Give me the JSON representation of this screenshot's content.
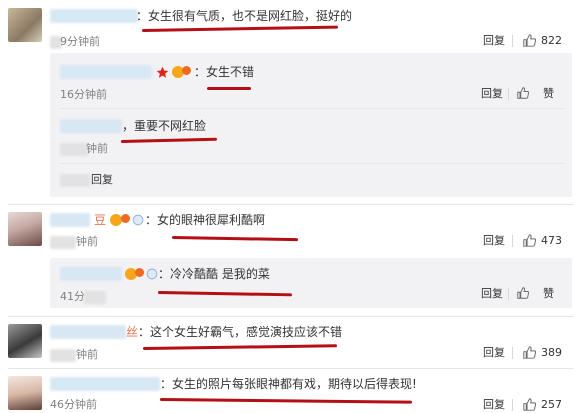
{
  "comments": [
    {
      "text": "：女生很有气质，也不是网红脸，挺好的",
      "time": "9分钟前",
      "reply": "回复",
      "likes": "822",
      "replies": [
        {
          "text": "：女生不错",
          "time": "16分钟前",
          "reply": "回复",
          "likes": "赞"
        },
        {
          "text": "，重要不网红脸",
          "time": "钟前",
          "reply": "",
          "likes": ""
        }
      ],
      "more_reply": "回复"
    },
    {
      "name_suffix": "豆",
      "text": "：女的眼神很犀利酷啊",
      "time": "钟前",
      "reply": "回复",
      "likes": "473",
      "replies": [
        {
          "text": "：冷冷酷酷 是我的菜",
          "time": "41分",
          "reply": "回复",
          "likes": "赞"
        }
      ]
    },
    {
      "name_suffix": "丝",
      "text": "：这个女生好霸气，感觉演技应该不错",
      "time": "钟前",
      "reply": "回复",
      "likes": "389"
    },
    {
      "text": "：女生的照片每张眼神都有戏，期待以后得表现!",
      "time": "46分钟前",
      "reply": "回复",
      "likes": "257"
    }
  ],
  "colors": {
    "reply_bg": "#f2f2f5",
    "underline": "#b30f14",
    "link": "#eb7350"
  }
}
